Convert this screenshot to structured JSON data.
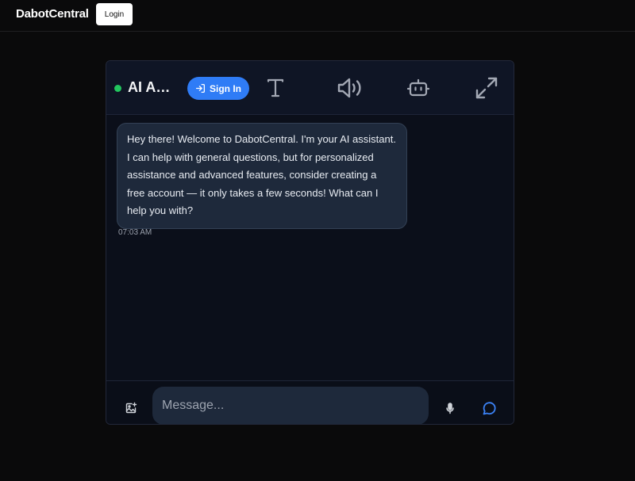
{
  "topbar": {
    "brand": "DabotCentral",
    "login_label": "Login"
  },
  "chat": {
    "title": "AI Assistant",
    "status": "online",
    "signin_label": "Sign In",
    "header_icons": [
      "text-size-icon",
      "speaker-icon",
      "bot-icon",
      "expand-icon"
    ],
    "messages": [
      {
        "role": "assistant",
        "text": "Hey there! Welcome to DabotCentral. I'm your AI assistant. I can help with general questions, but for personalized assistance and advanced features, consider creating a free account — it only takes a few seconds! What can I help you with?",
        "time": "07:03 AM"
      }
    ],
    "input": {
      "placeholder": "Message...",
      "value": ""
    }
  },
  "colors": {
    "accent": "#2f7cf6",
    "status_online": "#22c55e",
    "send": "#3b82f6"
  }
}
